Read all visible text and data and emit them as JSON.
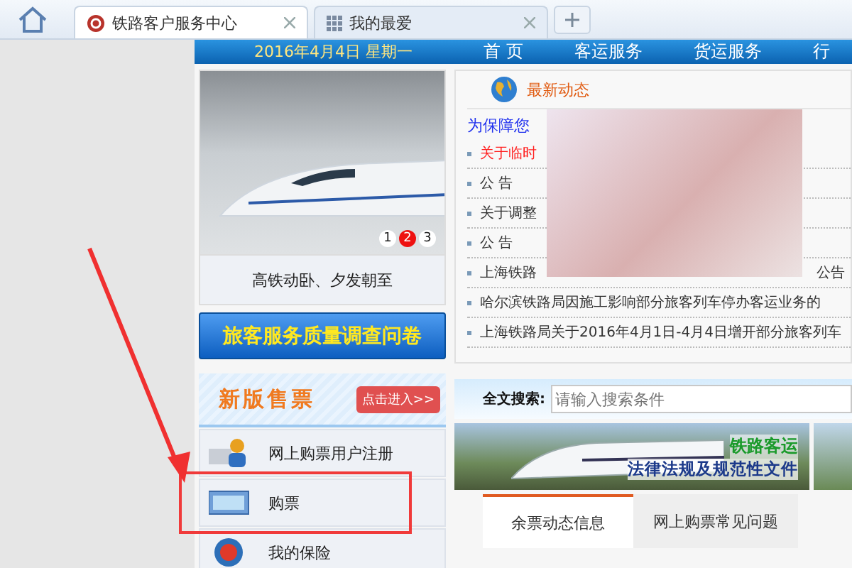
{
  "browser_tabs": [
    {
      "label": "铁路客户服务中心",
      "selected": true,
      "kind": "site"
    },
    {
      "label": "我的最爱",
      "selected": false,
      "kind": "grid"
    }
  ],
  "header": {
    "date": "2016年4月4日 星期一",
    "nav": [
      "首 页",
      "客运服务",
      "货运服务",
      "行"
    ]
  },
  "carousel": {
    "caption": "高铁动卧、夕发朝至",
    "dots": [
      {
        "label": "1",
        "selected": false
      },
      {
        "label": "2",
        "selected": true
      },
      {
        "label": "3",
        "selected": false
      }
    ]
  },
  "survey_button": "旅客服务质量调查问卷",
  "ticketing": {
    "title": "新版售票",
    "enter": "点击进入>>"
  },
  "menu": [
    {
      "label": "网上购票用户注册",
      "kind": "user",
      "highlighted": false
    },
    {
      "label": "购票",
      "kind": "computer",
      "highlighted": true
    },
    {
      "label": "我的保险",
      "kind": "insurance",
      "highlighted": false
    }
  ],
  "news": {
    "title": "最新动态",
    "intro": "为保障您",
    "items": [
      {
        "text": "关于临时",
        "color": "#ff2020"
      },
      {
        "text": "公 告",
        "color": "#333333"
      },
      {
        "text": "关于调整",
        "color": "#333333"
      },
      {
        "text": "公 告",
        "color": "#333333"
      },
      {
        "text": "上海铁路",
        "tail": "公告",
        "color": "#333333"
      },
      {
        "text": "哈尔滨铁路局因施工影响部分旅客列车停办客运业务的",
        "color": "#333333"
      },
      {
        "text": "上海铁路局关于2016年4月1日-4月4日增开部分旅客列车",
        "color": "#333333"
      }
    ]
  },
  "search": {
    "label": "全文搜索:",
    "placeholder": "请输入搜索条件"
  },
  "law_banner": {
    "line_1": "铁路客运",
    "line_2": "法律法规及规范性文件"
  },
  "info_tabs": [
    {
      "label": "余票动态信息",
      "selected": true
    },
    {
      "label": "网上购票常见问题",
      "selected": false
    }
  ]
}
